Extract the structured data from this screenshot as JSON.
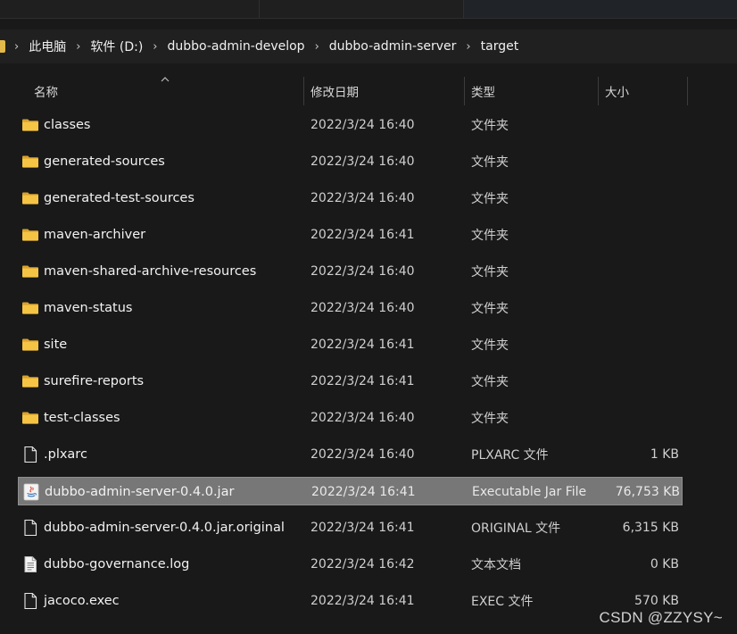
{
  "breadcrumb": [
    "此电脑",
    "软件 (D:)",
    "dubbo-admin-develop",
    "dubbo-admin-server",
    "target"
  ],
  "columns": {
    "name": "名称",
    "date": "修改日期",
    "type": "类型",
    "size": "大小"
  },
  "files": [
    {
      "name": "classes",
      "date": "2022/3/24 16:40",
      "type": "文件夹",
      "size": "",
      "icon": "folder-icon"
    },
    {
      "name": "generated-sources",
      "date": "2022/3/24 16:40",
      "type": "文件夹",
      "size": "",
      "icon": "folder-icon"
    },
    {
      "name": "generated-test-sources",
      "date": "2022/3/24 16:40",
      "type": "文件夹",
      "size": "",
      "icon": "folder-icon"
    },
    {
      "name": "maven-archiver",
      "date": "2022/3/24 16:41",
      "type": "文件夹",
      "size": "",
      "icon": "folder-icon"
    },
    {
      "name": "maven-shared-archive-resources",
      "date": "2022/3/24 16:40",
      "type": "文件夹",
      "size": "",
      "icon": "folder-icon"
    },
    {
      "name": "maven-status",
      "date": "2022/3/24 16:40",
      "type": "文件夹",
      "size": "",
      "icon": "folder-icon"
    },
    {
      "name": "site",
      "date": "2022/3/24 16:41",
      "type": "文件夹",
      "size": "",
      "icon": "folder-icon"
    },
    {
      "name": "surefire-reports",
      "date": "2022/3/24 16:41",
      "type": "文件夹",
      "size": "",
      "icon": "folder-icon"
    },
    {
      "name": "test-classes",
      "date": "2022/3/24 16:40",
      "type": "文件夹",
      "size": "",
      "icon": "folder-icon"
    },
    {
      "name": ".plxarc",
      "date": "2022/3/24 16:40",
      "type": "PLXARC 文件",
      "size": "1 KB",
      "icon": "file-icon"
    },
    {
      "name": "dubbo-admin-server-0.4.0.jar",
      "date": "2022/3/24 16:41",
      "type": "Executable Jar File",
      "size": "76,753 KB",
      "icon": "java-jar-icon",
      "selected": true
    },
    {
      "name": "dubbo-admin-server-0.4.0.jar.original",
      "date": "2022/3/24 16:41",
      "type": "ORIGINAL 文件",
      "size": "6,315 KB",
      "icon": "file-icon"
    },
    {
      "name": "dubbo-governance.log",
      "date": "2022/3/24 16:42",
      "type": "文本文档",
      "size": "0 KB",
      "icon": "text-document-icon"
    },
    {
      "name": "jacoco.exec",
      "date": "2022/3/24 16:41",
      "type": "EXEC 文件",
      "size": "570 KB",
      "icon": "file-icon"
    }
  ],
  "watermark": "CSDN @ZZYSY~",
  "colors": {
    "background": "#191919",
    "folder": "#f0c040",
    "selection": "#777777"
  }
}
